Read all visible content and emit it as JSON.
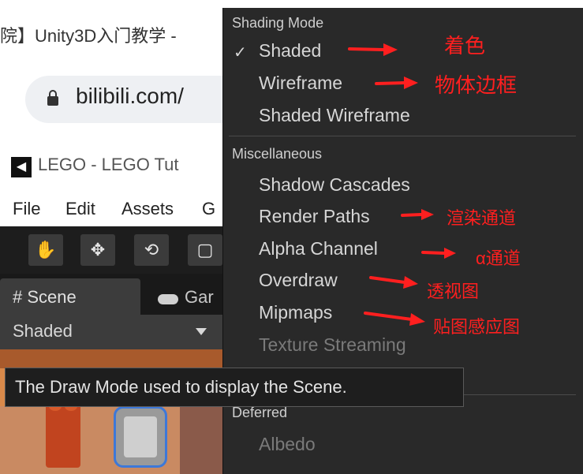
{
  "browser": {
    "tab_title": "院】Unity3D入门教学 -",
    "url": "bilibili.com/"
  },
  "unity": {
    "logo_glyph": "◀",
    "title": "LEGO - LEGO Tut",
    "menu": [
      "File",
      "Edit",
      "Assets",
      "G"
    ],
    "tools": [
      "✋",
      "✥",
      "⟲",
      "▢"
    ],
    "scene_tab": "# Scene",
    "game_tab": "Gar",
    "draw_mode": "Shaded"
  },
  "tooltip": "The Draw Mode used to display the Scene.",
  "menu": {
    "shading_header": "Shading Mode",
    "check_glyph": "✓",
    "shaded": "Shaded",
    "wireframe": "Wireframe",
    "shaded_wireframe": "Shaded Wireframe",
    "misc_header": "Miscellaneous",
    "shadow_cascades": "Shadow Cascades",
    "render_paths": "Render Paths",
    "alpha_channel": "Alpha Channel",
    "overdraw": "Overdraw",
    "mipmaps": "Mipmaps",
    "texture_streaming": "Texture Streaming",
    "deferred_header": "Deferred",
    "albedo": "Albedo"
  },
  "annotations": {
    "shaded": "着色",
    "wireframe": "物体边框",
    "render_paths": "渲染通道",
    "alpha_channel": "α通道",
    "overdraw": "透视图",
    "mipmaps": "贴图感应图"
  },
  "colors": {
    "annotation": "#ff1f1f",
    "menu_bg": "#292929",
    "selection_outline": "#3d78d8"
  }
}
